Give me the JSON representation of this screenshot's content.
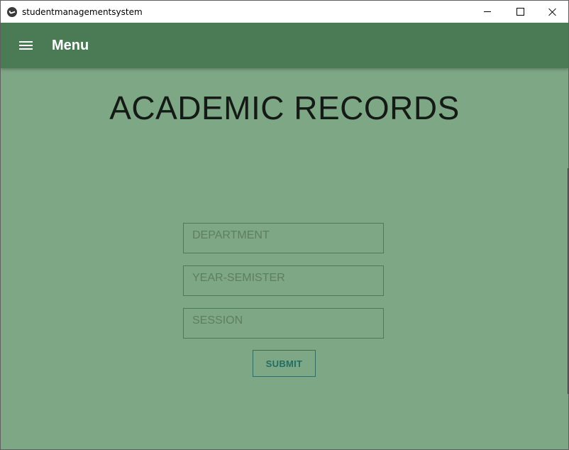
{
  "window": {
    "title": "studentmanagementsystem",
    "controls": [
      "minimize",
      "maximize",
      "close"
    ]
  },
  "appbar": {
    "menu_icon": "hamburger-menu-icon",
    "title": "Menu",
    "color": "#4a7b55"
  },
  "page": {
    "title": "ACADEMIC RECORDS",
    "background": "#7ea785"
  },
  "form": {
    "department": {
      "value": "",
      "placeholder": "DEPARTMENT"
    },
    "year_semester": {
      "value": "",
      "placeholder": "YEAR-SEMISTER"
    },
    "session": {
      "value": "",
      "placeholder": "SESSION"
    },
    "submit_label": "SUBMIT"
  }
}
